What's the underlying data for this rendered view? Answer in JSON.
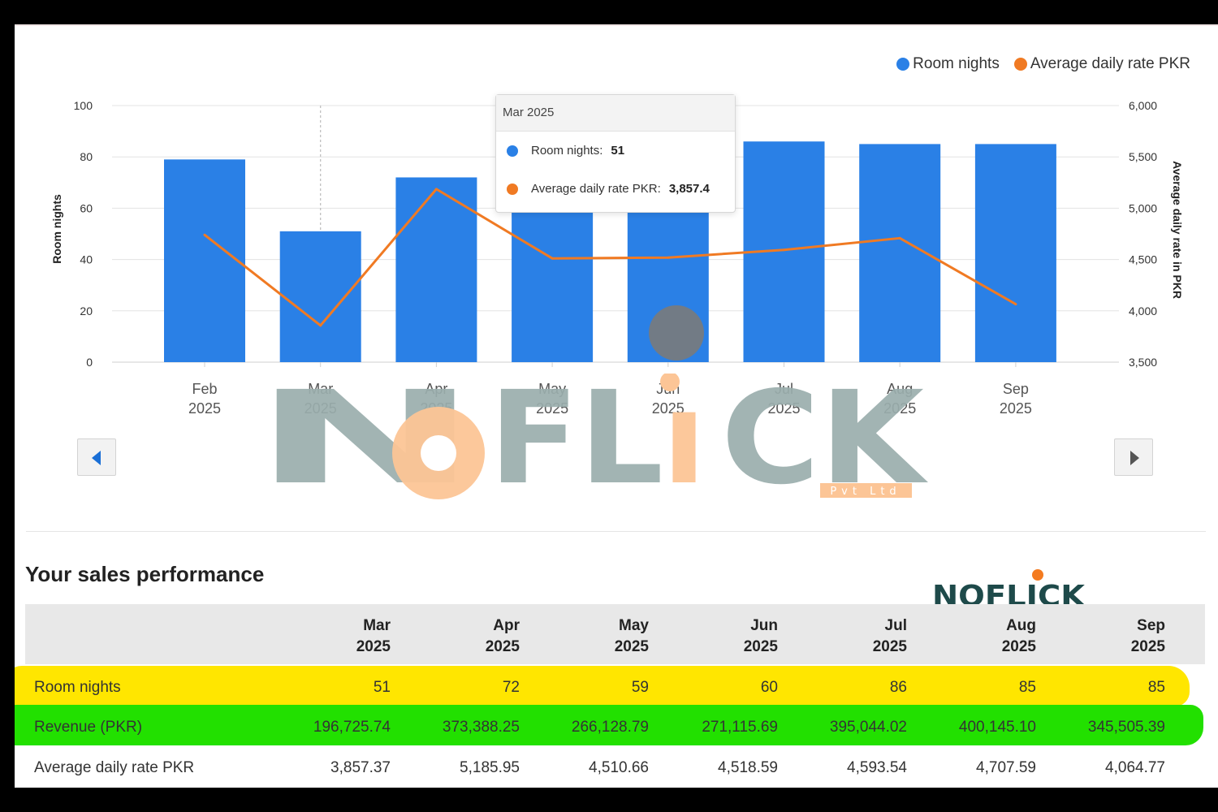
{
  "chart_data": {
    "type": "bar",
    "categories": [
      {
        "month": "Feb",
        "year": "2025"
      },
      {
        "month": "Mar",
        "year": "2025"
      },
      {
        "month": "Apr",
        "year": "2025"
      },
      {
        "month": "May",
        "year": "2025"
      },
      {
        "month": "Jun",
        "year": "2025"
      },
      {
        "month": "Jul",
        "year": "2025"
      },
      {
        "month": "Aug",
        "year": "2025"
      },
      {
        "month": "Sep",
        "year": "2025"
      }
    ],
    "series": [
      {
        "name": "Room nights",
        "kind": "bar",
        "axis": "left",
        "color": "#2a80e6",
        "values": [
          79,
          51,
          72,
          59,
          60,
          86,
          85,
          85
        ]
      },
      {
        "name": "Average daily rate PKR",
        "kind": "line",
        "axis": "right",
        "color": "#f07a23",
        "values": [
          4740,
          3857.4,
          5186,
          4511,
          4519,
          4594,
          4708,
          4065
        ]
      }
    ],
    "ylabel": "Room nights",
    "y2label": "Average daily rate in PKR",
    "ylim": [
      0,
      100
    ],
    "y2lim": [
      3500,
      6000
    ],
    "yticks": [
      "0",
      "20",
      "40",
      "60",
      "80",
      "100"
    ],
    "y2ticks": [
      "3,500",
      "4,000",
      "4,500",
      "5,000",
      "5,500",
      "6,000"
    ],
    "grid": true,
    "legend_position": "top-right",
    "highlighted_category": "Mar"
  },
  "legend": {
    "items": [
      {
        "label": "Room nights",
        "color": "#2a80e6"
      },
      {
        "label": "Average daily rate PKR",
        "color": "#f07a23"
      }
    ]
  },
  "tooltip": {
    "title": "Mar 2025",
    "rows": [
      {
        "label": "Room nights:",
        "value": "51",
        "color": "#2a80e6"
      },
      {
        "label": "Average daily rate PKR:",
        "value": "3,857.4",
        "color": "#f07a23"
      }
    ]
  },
  "navigation": {
    "prev_icon": "chevron-left-icon",
    "next_icon": "chevron-right-icon"
  },
  "watermark": {
    "text": "NOFLICK",
    "tagline": "Pvt Ltd"
  },
  "performance": {
    "title": "Your sales performance",
    "columns": [
      {
        "month": "Mar",
        "year": "2025"
      },
      {
        "month": "Apr",
        "year": "2025"
      },
      {
        "month": "May",
        "year": "2025"
      },
      {
        "month": "Jun",
        "year": "2025"
      },
      {
        "month": "Jul",
        "year": "2025"
      },
      {
        "month": "Aug",
        "year": "2025"
      },
      {
        "month": "Sep",
        "year": "2025"
      }
    ],
    "rows": [
      {
        "label": "Room nights",
        "values": [
          "51",
          "72",
          "59",
          "60",
          "86",
          "85",
          "85"
        ]
      },
      {
        "label": "Revenue (PKR)",
        "values": [
          "196,725.74",
          "373,388.25",
          "266,128.79",
          "271,115.69",
          "395,044.02",
          "400,145.10",
          "345,505.39"
        ]
      },
      {
        "label": "Average daily rate PKR",
        "values": [
          "3,857.37",
          "5,185.95",
          "4,510.66",
          "4,518.59",
          "4,593.54",
          "4,707.59",
          "4,064.77"
        ]
      }
    ]
  },
  "colors": {
    "bar": "#2a80e6",
    "line": "#f07a23",
    "highlight_yellow": "#ffe600",
    "highlight_green": "#22e000",
    "watermark_gray": "#9aaeac",
    "watermark_orange": "#fcc596",
    "watermark_dark": "#1e4a4a",
    "watermark_accent": "#f47b20"
  }
}
